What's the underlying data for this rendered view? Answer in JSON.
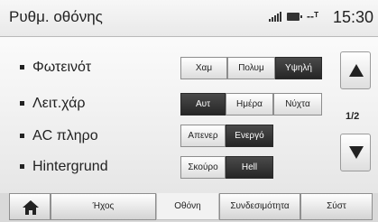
{
  "header": {
    "title": "Ρυθμ. οθόνης",
    "network_status": "--ᵀ",
    "time": "15:30"
  },
  "settings": [
    {
      "label": "Φωτεινότ",
      "options": [
        "Χαμ",
        "Πολυμ",
        "Υψηλή"
      ],
      "selected": "Υψηλή"
    },
    {
      "label": "Λειτ.χάρ",
      "options": [
        "Αυτ",
        "Ημέρα",
        "Νύχτα"
      ],
      "selected": "Αυτ"
    },
    {
      "label": "AC πληρο",
      "options": [
        "Απενερ",
        "Ενεργό"
      ],
      "selected": "Ενεργό"
    },
    {
      "label": "Hintergrund",
      "options": [
        "Σκούρο",
        "Hell"
      ],
      "selected": "Hell"
    }
  ],
  "pagination": {
    "page_indicator": "1/2"
  },
  "tabs": [
    {
      "label": "Ήχος"
    },
    {
      "label": "Οθόνη",
      "active": true
    },
    {
      "label": "Συνδεσιμότητα"
    },
    {
      "label": "Σύστ"
    }
  ],
  "icons": {
    "home": "home-icon",
    "up": "arrow-up-icon",
    "down": "arrow-down-icon",
    "signal": "signal-icon",
    "battery": "battery-icon"
  },
  "colors": {
    "active_segment": "#2f2f2f",
    "inactive_segment": "#f2f2f2"
  }
}
